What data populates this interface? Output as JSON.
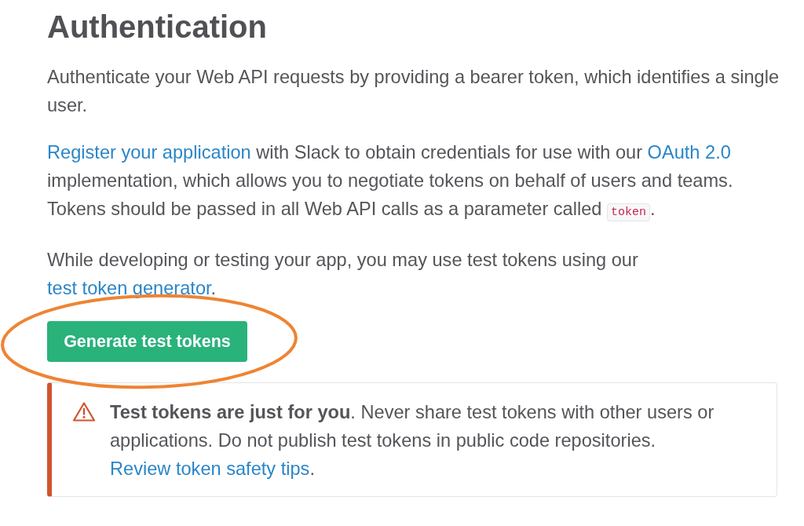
{
  "heading": "Authentication",
  "paragraphs": [
    {
      "parts": [
        {
          "kind": "text",
          "text": "Authenticate your Web API requests by providing a bearer token, which identifies a single user."
        }
      ]
    },
    {
      "parts": [
        {
          "kind": "link",
          "text": "Register your application"
        },
        {
          "kind": "text",
          "text": " with Slack to obtain credentials for use with our "
        },
        {
          "kind": "link",
          "text": "OAuth 2.0"
        },
        {
          "kind": "text",
          "text": " implementation, which allows you to negotiate tokens on behalf of users and teams. Tokens should be passed in all Web API calls as a parameter called "
        },
        {
          "kind": "code",
          "text": "token"
        },
        {
          "kind": "text",
          "text": "."
        }
      ]
    },
    {
      "parts": [
        {
          "kind": "text",
          "text": "While developing or testing your app, you may use test tokens using our "
        },
        {
          "kind": "link",
          "text": "test token generator"
        },
        {
          "kind": "text",
          "text": "."
        }
      ]
    }
  ],
  "button": {
    "label": "Generate test tokens",
    "highlighted": true
  },
  "callout": {
    "kind": "warning",
    "parts": [
      {
        "kind": "text",
        "text": "**Test tokens are just for you**. Never share test tokens with other users or applications. Do not publish test tokens in public code repositories. "
      },
      {
        "kind": "link",
        "text": "Review token safety tips"
      },
      {
        "kind": "text",
        "text": "."
      }
    ]
  }
}
